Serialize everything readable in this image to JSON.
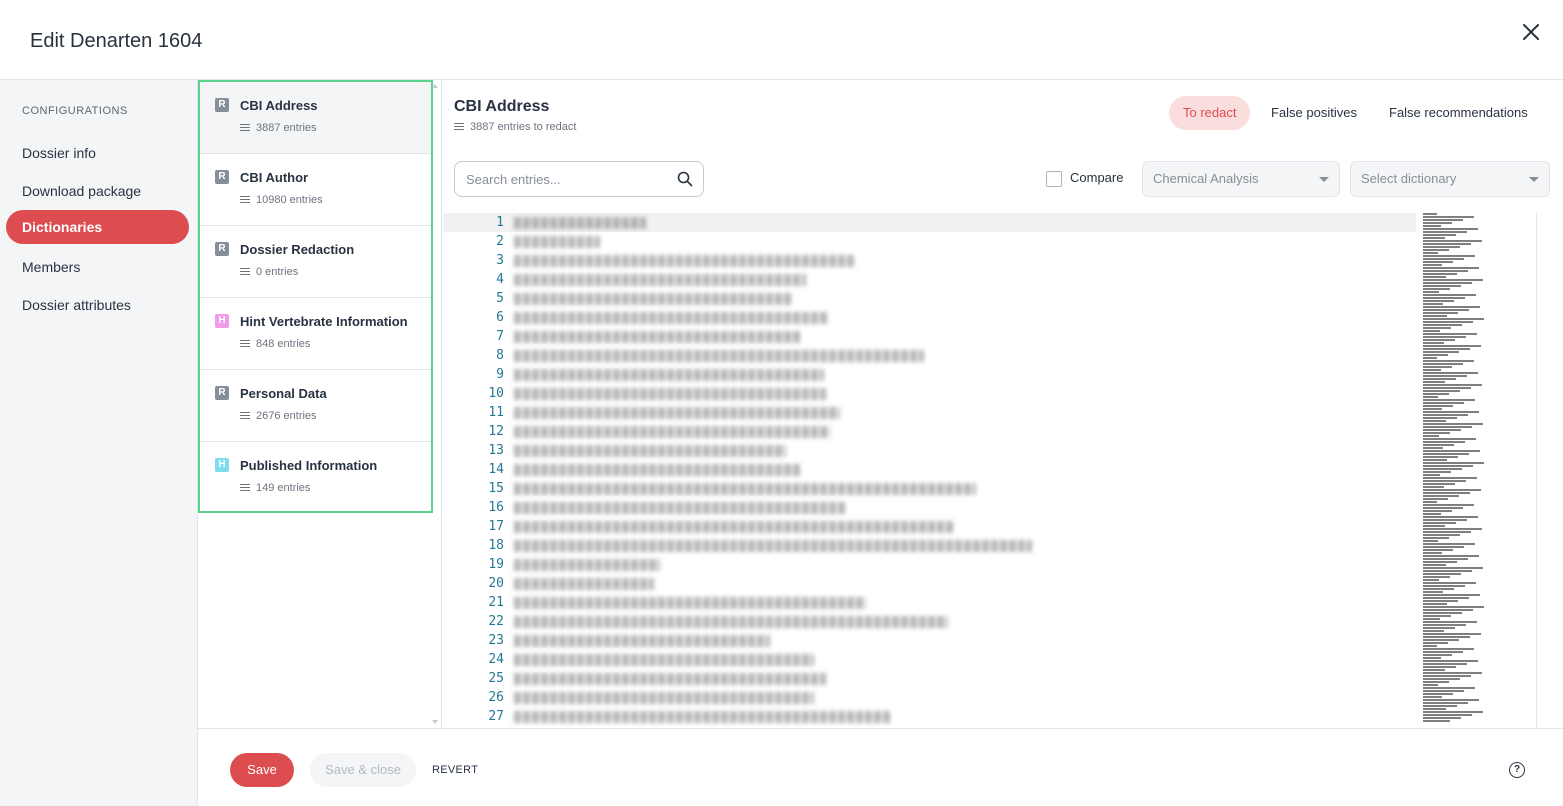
{
  "header": {
    "title": "Edit Denarten 1604"
  },
  "sidebar": {
    "heading": "CONFIGURATIONS",
    "items": [
      {
        "label": "Dossier info",
        "active": false
      },
      {
        "label": "Download package",
        "active": false
      },
      {
        "label": "Dictionaries",
        "active": true
      },
      {
        "label": "Members",
        "active": false
      },
      {
        "label": "Dossier attributes",
        "active": false
      }
    ]
  },
  "dictionaries": [
    {
      "badge": "R",
      "badge_color": "#868e99",
      "name": "CBI Address",
      "count": "3887 entries",
      "selected": true
    },
    {
      "badge": "R",
      "badge_color": "#868e99",
      "name": "CBI Author",
      "count": "10980 entries",
      "selected": false
    },
    {
      "badge": "R",
      "badge_color": "#868e99",
      "name": "Dossier Redaction",
      "count": "0 entries",
      "selected": false
    },
    {
      "badge": "H",
      "badge_color": "#f19bea",
      "name": "Hint Vertebrate Information",
      "count": "848 entries",
      "selected": false
    },
    {
      "badge": "R",
      "badge_color": "#868e99",
      "name": "Personal Data",
      "count": "2676 entries",
      "selected": false
    },
    {
      "badge": "H",
      "badge_color": "#7fdcef",
      "name": "Published Information",
      "count": "149 entries",
      "selected": false
    }
  ],
  "main": {
    "title": "CBI Address",
    "subtitle": "3887 entries to redact",
    "tabs": [
      {
        "label": "To redact",
        "active": true
      },
      {
        "label": "False positives",
        "active": false
      },
      {
        "label": "False recommendations",
        "active": false
      }
    ],
    "search": {
      "placeholder": "Search entries...",
      "value": ""
    },
    "compare_label": "Compare",
    "compare_checked": false,
    "template_select": "Chemical Analysis",
    "dictionary_select": "Select dictionary"
  },
  "editor": {
    "line_numbers": [
      "1",
      "2",
      "3",
      "4",
      "5",
      "6",
      "7",
      "8",
      "9",
      "10",
      "11",
      "12",
      "13",
      "14",
      "15",
      "16",
      "17",
      "18",
      "19",
      "20",
      "21",
      "22",
      "23",
      "24",
      "25",
      "26",
      "27"
    ],
    "lines_redacted": true
  },
  "footer": {
    "save": "Save",
    "save_close": "Save & close",
    "revert": "REVERT",
    "help": "?"
  },
  "colors": {
    "accent": "#dd4d50",
    "selection_outline": "#5cd38a",
    "tab_active_bg": "#fadede"
  }
}
